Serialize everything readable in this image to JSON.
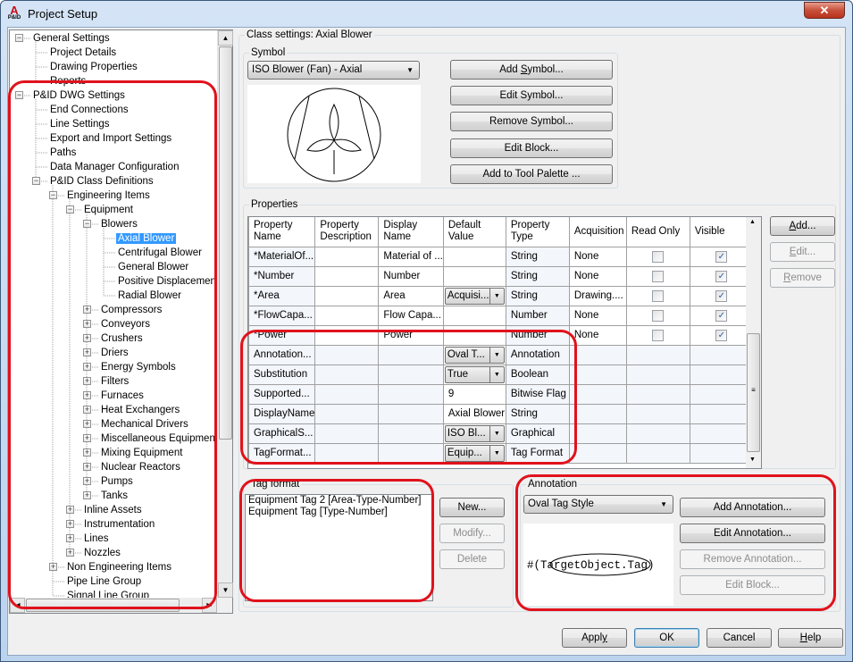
{
  "window": {
    "title": "Project Setup",
    "app_icon_letters": "A",
    "app_icon_caption": "P&ID",
    "close_glyph": "✕"
  },
  "tree": {
    "nodes": [
      {
        "label": "General Settings",
        "level": 0,
        "expander": "minus"
      },
      {
        "label": "Project Details",
        "level": 1,
        "expander": "none"
      },
      {
        "label": "Drawing Properties",
        "level": 1,
        "expander": "none"
      },
      {
        "label": "Reports",
        "level": 1,
        "expander": "none"
      },
      {
        "label": "P&ID DWG Settings",
        "level": 0,
        "expander": "minus"
      },
      {
        "label": "End Connections",
        "level": 1,
        "expander": "none"
      },
      {
        "label": "Line Settings",
        "level": 1,
        "expander": "none"
      },
      {
        "label": "Export and Import Settings",
        "level": 1,
        "expander": "none"
      },
      {
        "label": "Paths",
        "level": 1,
        "expander": "none"
      },
      {
        "label": "Data Manager Configuration",
        "level": 1,
        "expander": "none"
      },
      {
        "label": "P&ID Class Definitions",
        "level": 1,
        "expander": "minus"
      },
      {
        "label": "Engineering Items",
        "level": 2,
        "expander": "minus"
      },
      {
        "label": "Equipment",
        "level": 3,
        "expander": "minus"
      },
      {
        "label": "Blowers",
        "level": 4,
        "expander": "minus"
      },
      {
        "label": "Axial Blower",
        "level": 5,
        "expander": "none",
        "selected": true
      },
      {
        "label": "Centrifugal Blower",
        "level": 5,
        "expander": "none"
      },
      {
        "label": "General Blower",
        "level": 5,
        "expander": "none"
      },
      {
        "label": "Positive Displacement Blower",
        "level": 5,
        "expander": "none"
      },
      {
        "label": "Radial Blower",
        "level": 5,
        "expander": "none"
      },
      {
        "label": "Compressors",
        "level": 4,
        "expander": "plus"
      },
      {
        "label": "Conveyors",
        "level": 4,
        "expander": "plus"
      },
      {
        "label": "Crushers",
        "level": 4,
        "expander": "plus"
      },
      {
        "label": "Driers",
        "level": 4,
        "expander": "plus"
      },
      {
        "label": "Energy Symbols",
        "level": 4,
        "expander": "plus"
      },
      {
        "label": "Filters",
        "level": 4,
        "expander": "plus"
      },
      {
        "label": "Furnaces",
        "level": 4,
        "expander": "plus"
      },
      {
        "label": "Heat Exchangers",
        "level": 4,
        "expander": "plus"
      },
      {
        "label": "Mechanical Drivers",
        "level": 4,
        "expander": "plus"
      },
      {
        "label": "Miscellaneous Equipment",
        "level": 4,
        "expander": "plus"
      },
      {
        "label": "Mixing Equipment",
        "level": 4,
        "expander": "plus"
      },
      {
        "label": "Nuclear Reactors",
        "level": 4,
        "expander": "plus"
      },
      {
        "label": "Pumps",
        "level": 4,
        "expander": "plus"
      },
      {
        "label": "Tanks",
        "level": 4,
        "expander": "plus"
      },
      {
        "label": "Inline Assets",
        "level": 3,
        "expander": "plus"
      },
      {
        "label": "Instrumentation",
        "level": 3,
        "expander": "plus"
      },
      {
        "label": "Lines",
        "level": 3,
        "expander": "plus"
      },
      {
        "label": "Nozzles",
        "level": 3,
        "expander": "plus"
      },
      {
        "label": "Non Engineering Items",
        "level": 2,
        "expander": "plus"
      },
      {
        "label": "Pipe Line Group",
        "level": 2,
        "expander": "none"
      },
      {
        "label": "Signal Line Group",
        "level": 2,
        "expander": "none"
      }
    ]
  },
  "class_settings": {
    "title": "Class settings: Axial Blower",
    "symbol": {
      "group_title": "Symbol",
      "selected": "ISO Blower (Fan) - Axial",
      "buttons": {
        "add": {
          "pre": "Add ",
          "u": "S",
          "post": "ymbol..."
        },
        "edit": "Edit Symbol...",
        "remove": "Remove Symbol...",
        "edit_block": "Edit Block...",
        "add_tool_palette": "Add to Tool Palette ..."
      }
    },
    "properties": {
      "group_title": "Properties",
      "columns": [
        "Property Name",
        "Property Description",
        "Display Name",
        "Default Value",
        "Property Type",
        "Acquisition",
        "Read Only",
        "Visible"
      ],
      "rows": [
        {
          "name": "*MaterialOf...",
          "description": "",
          "display": "Material of ...",
          "default": "",
          "default_combo": false,
          "type": "String",
          "acquisition": "None",
          "read_only": false,
          "visible": true,
          "has_checks": true
        },
        {
          "name": "*Number",
          "description": "",
          "display": "Number",
          "default": "",
          "default_combo": false,
          "type": "String",
          "acquisition": "None",
          "read_only": false,
          "visible": true,
          "has_checks": true
        },
        {
          "name": "*Area",
          "description": "",
          "display": "Area",
          "default": "Acquisi...",
          "default_combo": true,
          "type": "String",
          "acquisition": "Drawing....",
          "read_only": false,
          "visible": true,
          "has_checks": true
        },
        {
          "name": "*FlowCapa...",
          "description": "",
          "display": "Flow Capa...",
          "default": "",
          "default_combo": false,
          "type": "Number",
          "acquisition": "None",
          "read_only": false,
          "visible": true,
          "has_checks": true
        },
        {
          "name": "*Power",
          "description": "",
          "display": "Power",
          "default": "",
          "default_combo": false,
          "type": "Number",
          "acquisition": "None",
          "read_only": false,
          "visible": true,
          "has_checks": true
        },
        {
          "name": "Annotation...",
          "description": "",
          "display": "",
          "default": "Oval T...",
          "default_combo": true,
          "type": "Annotation",
          "acquisition": "",
          "has_checks": false
        },
        {
          "name": "Substitution",
          "description": "",
          "display": "",
          "default": "True",
          "default_combo": true,
          "type": "Boolean",
          "acquisition": "",
          "has_checks": false
        },
        {
          "name": "Supported...",
          "description": "",
          "display": "",
          "default": "9",
          "default_combo": false,
          "type": "Bitwise Flag",
          "acquisition": "",
          "has_checks": false
        },
        {
          "name": "DisplayName",
          "description": "",
          "display": "",
          "default": "Axial Blower",
          "default_combo": false,
          "type": "String",
          "acquisition": "",
          "has_checks": false
        },
        {
          "name": "GraphicalS...",
          "description": "",
          "display": "",
          "default": "ISO Bl...",
          "default_combo": true,
          "type": "Graphical",
          "acquisition": "",
          "has_checks": false
        },
        {
          "name": "TagFormat...",
          "description": "",
          "display": "",
          "default": "Equip...",
          "default_combo": true,
          "type": "Tag Format",
          "acquisition": "",
          "has_checks": false
        }
      ],
      "buttons": {
        "add": {
          "u": "A",
          "post": "dd..."
        },
        "edit": {
          "u": "E",
          "post": "dit..."
        },
        "remove": {
          "u": "R",
          "post": "emove"
        }
      }
    },
    "tag_format": {
      "group_title": "Tag format",
      "items": [
        "Equipment Tag 2 [Area-Type-Number]",
        "Equipment Tag [Type-Number]"
      ],
      "buttons": {
        "new": "New...",
        "modify": "Modify...",
        "delete": "Delete"
      }
    },
    "annotation": {
      "group_title": "Annotation",
      "selected": "Oval Tag Style",
      "preview_text": "#(TargetObject.Tag)",
      "buttons": {
        "add": "Add Annotation...",
        "edit": "Edit Annotation...",
        "remove": "Remove Annotation...",
        "edit_block": "Edit Block..."
      }
    }
  },
  "footer": {
    "apply": {
      "pre": "Appl",
      "u": "y"
    },
    "ok": "OK",
    "cancel": "Cancel",
    "help": {
      "u": "H",
      "post": "elp"
    }
  },
  "colors": {
    "selection": "#3399ff",
    "highlight_annotation": "#e0121c"
  }
}
